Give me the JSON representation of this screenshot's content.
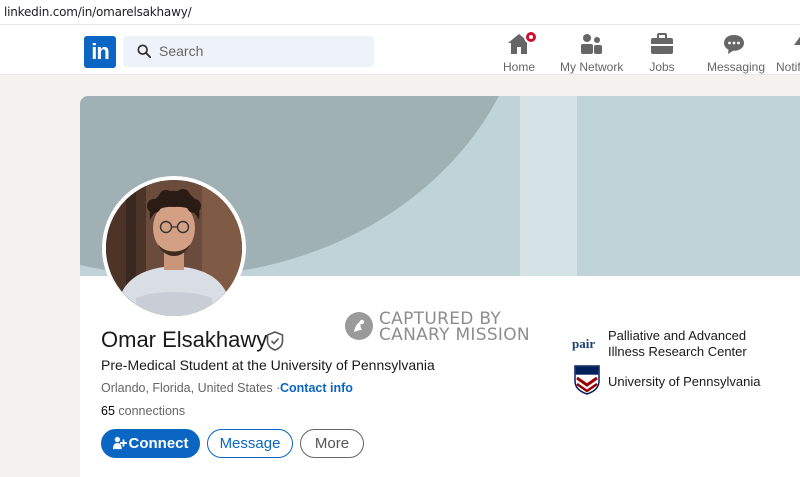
{
  "browser": {
    "url": "linkedin.com/in/omarelsakhawy/"
  },
  "nav": {
    "logo_text": "in",
    "search_placeholder": "Search",
    "items": [
      {
        "label": "Home",
        "icon": "home-icon"
      },
      {
        "label": "My Network",
        "icon": "network-icon"
      },
      {
        "label": "Jobs",
        "icon": "briefcase-icon"
      },
      {
        "label": "Messaging",
        "icon": "messaging-icon"
      },
      {
        "label": "Notif",
        "icon": "bell-icon"
      }
    ]
  },
  "profile": {
    "name": "Omar Elsakhawy",
    "headline": "Pre-Medical Student at the University of Pennsylvania",
    "location": "Orlando, Florida, United States",
    "separator": "·",
    "contact_info": "Contact info",
    "connections_count": "65",
    "connections_label": "connections",
    "actions": {
      "connect": "Connect",
      "message": "Message",
      "more": "More"
    }
  },
  "watermark": {
    "line1": "CAPTURED BY",
    "line2": "CANARY MISSION"
  },
  "experience": [
    {
      "logo_text": "pair",
      "name": "Palliative and Advanced Illness Research Center"
    },
    {
      "name": "University of Pennsylvania"
    }
  ],
  "colors": {
    "brand": "#0a66c2",
    "badge": "#cb112d"
  }
}
